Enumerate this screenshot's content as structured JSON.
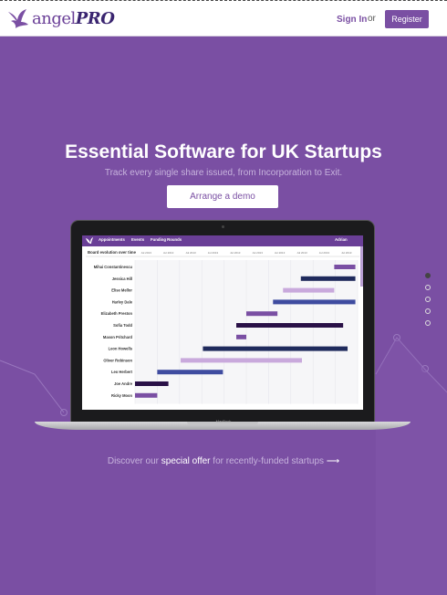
{
  "header": {
    "logo_word": "angel",
    "logo_pro": "PRO",
    "signin_label": "Sign In",
    "or_label": "or",
    "register_label": "Register"
  },
  "hero": {
    "title": "Essential Software for UK Startups",
    "subtitle": "Track every single share issued, from Incorporation to Exit.",
    "cta_label": "Arrange a demo"
  },
  "app": {
    "nav": [
      "Appointments",
      "Events",
      "Funding Rounds"
    ],
    "user": "Adrian",
    "chart_title": "Board evolution over time",
    "ticks": [
      "Jul 2013",
      "Jul 2013",
      "Jul 2013",
      "Jul 2013",
      "Jul 2013",
      "Jul 2013",
      "Jul 2013",
      "Jul 2013",
      "Jul 2013",
      "Jul 2013"
    ]
  },
  "chart_data": {
    "type": "bar",
    "title": "Board evolution over time",
    "rows": [
      {
        "name": "Mihai Constantinescu",
        "start": 0.895,
        "end": 0.99,
        "color": "#7a4fa3"
      },
      {
        "name": "Jessica Hill",
        "start": 0.745,
        "end": 0.99,
        "color": "#1f2a5c"
      },
      {
        "name": "Elise Mellor",
        "start": 0.665,
        "end": 0.895,
        "color": "#c9a9dc"
      },
      {
        "name": "Harley Dale",
        "start": 0.62,
        "end": 0.99,
        "color": "#3f4ca0"
      },
      {
        "name": "Elizabeth Preston",
        "start": 0.5,
        "end": 0.64,
        "color": "#7a4fa3"
      },
      {
        "name": "Sofia Todd",
        "start": 0.455,
        "end": 0.935,
        "color": "#2a1147"
      },
      {
        "name": "Mason Pritchard",
        "start": 0.455,
        "end": 0.5,
        "color": "#7a4fa3"
      },
      {
        "name": "Leon Howells",
        "start": 0.305,
        "end": 0.955,
        "color": "#1f2a5c"
      },
      {
        "name": "Oliver Robinson",
        "start": 0.205,
        "end": 0.75,
        "color": "#c9a9dc"
      },
      {
        "name": "Leo Herbert",
        "start": 0.1,
        "end": 0.395,
        "color": "#3f4ca0"
      },
      {
        "name": "Joe Andre",
        "start": 0.0,
        "end": 0.15,
        "color": "#2a1147"
      },
      {
        "name": "Ricky Moon",
        "start": 0.0,
        "end": 0.1,
        "color": "#7a4fa3"
      }
    ]
  },
  "laptop": {
    "brand": "MacBook"
  },
  "slider": {
    "count": 5,
    "active": 0
  },
  "offer": {
    "prefix": "Discover our",
    "link": "special offer",
    "suffix": "for recently-funded startups",
    "arrow": "⟶"
  }
}
